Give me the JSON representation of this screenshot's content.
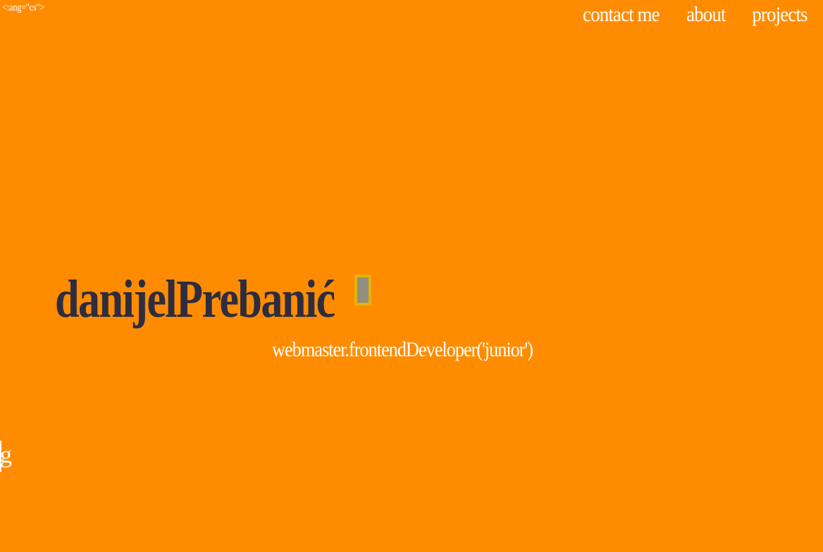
{
  "page": {
    "background_color": "#ff8c00",
    "text_color": "#ffffff",
    "name_color": "#2e2c3f",
    "cursor_color": "#e4b20a"
  },
  "stray_text": {
    "top_left": "<:ang=\"cs\">",
    "bottom_left": "g"
  },
  "nav": {
    "items": [
      {
        "label": "contact me"
      },
      {
        "label": "about"
      },
      {
        "label": "projects"
      }
    ]
  },
  "hero": {
    "name": "danijelPrebanić",
    "subtitle": "webmaster.frontendDeveloper('junior')"
  }
}
